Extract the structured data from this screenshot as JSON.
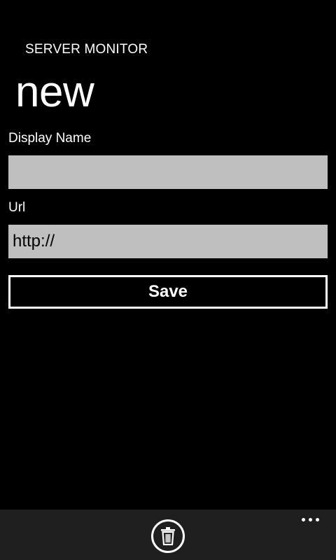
{
  "header": {
    "app_title": "SERVER MONITOR",
    "page_title": "new"
  },
  "form": {
    "display_name": {
      "label": "Display Name",
      "value": ""
    },
    "url": {
      "label": "Url",
      "value": "http://"
    },
    "save_label": "Save"
  },
  "app_bar": {
    "icons": [
      "delete-icon",
      "more-icon"
    ]
  },
  "colors": {
    "background": "#000000",
    "input_fill": "#bfbfbf",
    "app_bar": "#1f1f1f",
    "foreground": "#ffffff"
  }
}
